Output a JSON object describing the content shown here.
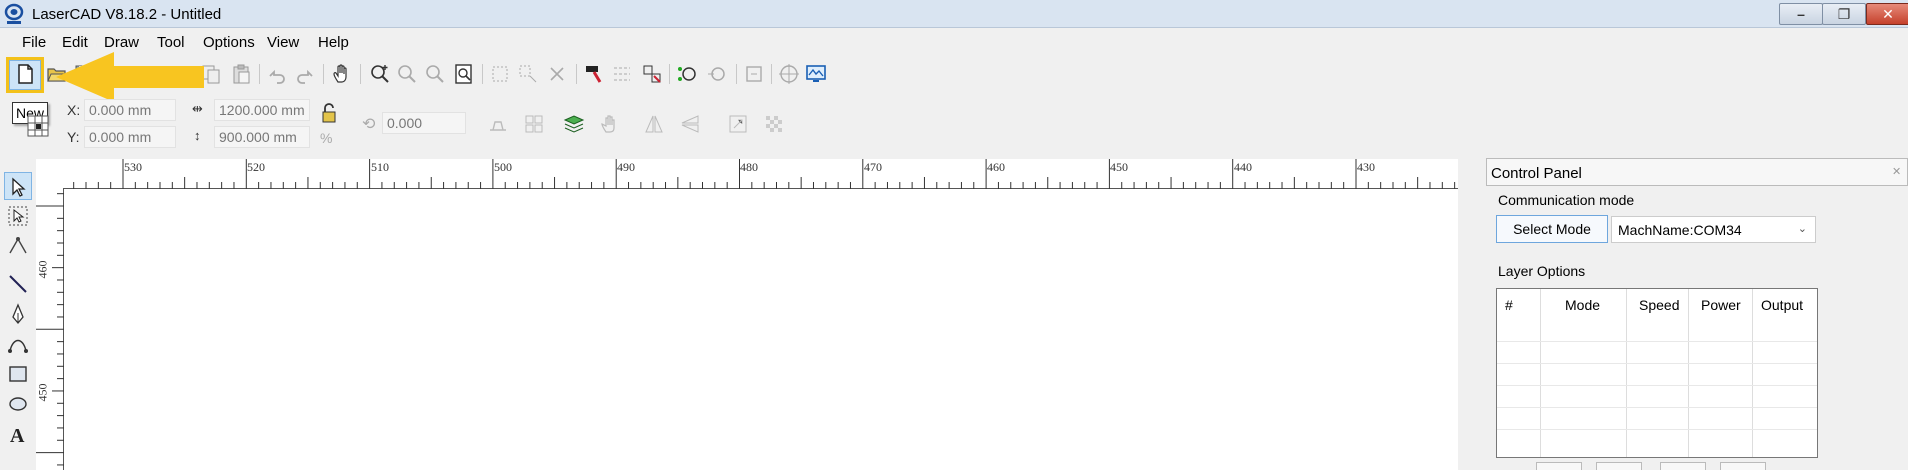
{
  "window": {
    "title": "LaserCAD V8.18.2 - Untitled"
  },
  "menu": {
    "items": [
      "File",
      "Edit",
      "Draw",
      "Tool",
      "Options",
      "View",
      "Help"
    ]
  },
  "tooltip": {
    "text": "New"
  },
  "toolbar": {
    "icons": [
      "new-file-icon",
      "open-folder-icon",
      "save-icon",
      "copy-icon",
      "paste-icon",
      "undo-icon",
      "redo-icon",
      "hand-pan-icon",
      "zoom-in-icon",
      "zoom-out-icon",
      "zoom-window-icon",
      "zoom-page-icon",
      "group-icon",
      "ungroup-icon",
      "delete-group-icon",
      "hammer-icon",
      "array-icon",
      "node-edit-icon",
      "path-icon",
      "rotate-path-icon",
      "output-icon",
      "locate-icon",
      "monitor-icon"
    ]
  },
  "properties": {
    "x_label": "X:",
    "y_label": "Y:",
    "x_value": "0.000 mm",
    "y_value": "0.000 mm",
    "width_value": "1200.000 mm",
    "height_value": "900.000 mm",
    "rotation_value": "0.000",
    "percent_symbol": "%"
  },
  "ruler": {
    "horizontal_labels": [
      "530",
      "520",
      "510",
      "500",
      "490",
      "480",
      "470",
      "460",
      "450",
      "440",
      "430"
    ],
    "vertical_labels": [
      "460",
      "450"
    ]
  },
  "control_panel": {
    "title": "Control Panel",
    "communication_mode_label": "Communication mode",
    "select_mode_button": "Select Mode",
    "machine_selected": "MachName:COM34",
    "layer_options_label": "Layer Options",
    "layer_columns": [
      "#",
      "Mode",
      "Speed",
      "Power",
      "Output"
    ]
  },
  "colors": {
    "titlebar": "#d9e4f1",
    "highlight": "#f3c11a",
    "active_tool": "#cde4f7"
  }
}
